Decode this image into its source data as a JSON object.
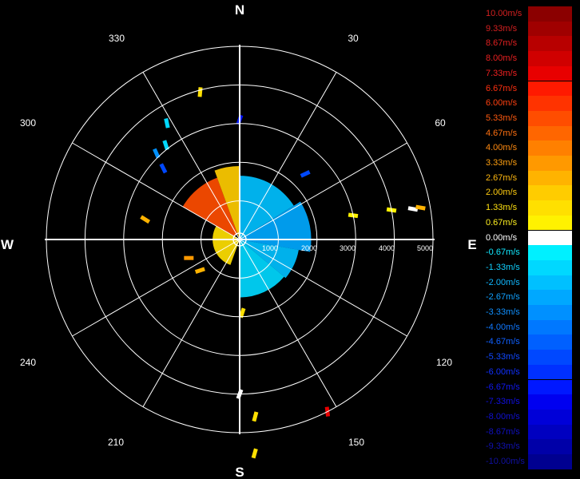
{
  "compass": {
    "north": "N",
    "south": "S",
    "east": "E",
    "west": "W",
    "bearings": [
      "30",
      "60",
      "120",
      "150",
      "210",
      "240",
      "300",
      "330"
    ]
  },
  "range_labels": [
    "1000",
    "2000",
    "3000",
    "4000",
    "5000"
  ],
  "colors": {
    "background": "#000000",
    "grid": "#ffffff"
  },
  "chart_data": {
    "type": "polar radial-velocity scan",
    "range_ticks": [
      1000,
      2000,
      3000,
      4000,
      5000
    ],
    "max_range": 5000,
    "bearing_ticks": [
      30,
      60,
      120,
      150,
      210,
      240,
      300,
      330
    ],
    "legend_placement": "right",
    "sectors": [
      {
        "az0": 0,
        "az1": 58,
        "r0": 0,
        "r1": 1650,
        "velocity": -2.0
      },
      {
        "az0": 58,
        "az1": 100,
        "r0": 0,
        "r1": 1850,
        "velocity": -2.67
      },
      {
        "az0": 100,
        "az1": 130,
        "r0": 0,
        "r1": 1550,
        "velocity": -2.0
      },
      {
        "az0": 130,
        "az1": 180,
        "r0": 0,
        "r1": 1500,
        "velocity": -1.33
      },
      {
        "az0": 300,
        "az1": 340,
        "r0": 150,
        "r1": 1700,
        "velocity": 5.33
      },
      {
        "az0": 340,
        "az1": 360,
        "r0": 0,
        "r1": 1900,
        "velocity": 2.0
      },
      {
        "az0": 200,
        "az1": 300,
        "r0": 0,
        "r1": 700,
        "velocity": 1.33
      }
    ],
    "returns": [
      {
        "az": 345,
        "range": 3950,
        "velocity": 1.33
      },
      {
        "az": 328,
        "range": 3550,
        "velocity": -1.33
      },
      {
        "az": 322,
        "range": 3100,
        "velocity": -1.33
      },
      {
        "az": 316,
        "range": 3100,
        "velocity": -3.33
      },
      {
        "az": 313,
        "range": 2700,
        "velocity": -5.33
      },
      {
        "az": 0,
        "range": 3100,
        "velocity": -6.67
      },
      {
        "az": 45,
        "range": 2400,
        "velocity": -5.33
      },
      {
        "az": 78,
        "range": 3000,
        "velocity": 0.67
      },
      {
        "az": 79,
        "range": 4000,
        "velocity": 0.67
      },
      {
        "az": 80,
        "range": 4550,
        "velocity": 0.0
      },
      {
        "az": 80,
        "range": 4750,
        "velocity": 2.67
      },
      {
        "az": 282,
        "range": 2500,
        "velocity": 2.67
      },
      {
        "az": 250,
        "range": 1400,
        "velocity": 3.33
      },
      {
        "az": 232,
        "range": 1300,
        "velocity": 2.67
      },
      {
        "az": 153,
        "range": 5000,
        "velocity": 7.33
      },
      {
        "az": 175,
        "range": 4600,
        "velocity": 1.33
      },
      {
        "az": 176,
        "range": 5550,
        "velocity": 1.33
      },
      {
        "az": 178,
        "range": 1900,
        "velocity": 1.33
      },
      {
        "az": 180,
        "range": 4000,
        "velocity": 0.0
      }
    ]
  },
  "legend": [
    {
      "label": "10.00m/s",
      "color": "#8b0000",
      "text": "#d42020"
    },
    {
      "label": "9.33m/s",
      "color": "#a00000",
      "text": "#d42020"
    },
    {
      "label": "8.67m/s",
      "color": "#b80000",
      "text": "#e02020"
    },
    {
      "label": "8.00m/s",
      "color": "#d00000",
      "text": "#e82020"
    },
    {
      "label": "7.33m/s",
      "color": "#e80000",
      "text": "#f02020"
    },
    {
      "label": "6.67m/s",
      "color": "#ff1a00",
      "text": "#ff3010"
    },
    {
      "label": "6.00m/s",
      "color": "#ff3300",
      "text": "#ff4010"
    },
    {
      "label": "5.33m/s",
      "color": "#ff4d00",
      "text": "#ff5a10"
    },
    {
      "label": "4.67m/s",
      "color": "#ff6600",
      "text": "#ff7010"
    },
    {
      "label": "4.00m/s",
      "color": "#ff8000",
      "text": "#ff8a10"
    },
    {
      "label": "3.33m/s",
      "color": "#ff9900",
      "text": "#ffa010"
    },
    {
      "label": "2.67m/s",
      "color": "#ffb300",
      "text": "#ffb810"
    },
    {
      "label": "2.00m/s",
      "color": "#ffcc00",
      "text": "#ffcc10"
    },
    {
      "label": "1.33m/s",
      "color": "#ffe000",
      "text": "#ffe010"
    },
    {
      "label": "0.67m/s",
      "color": "#fff200",
      "text": "#fff020"
    },
    {
      "label": "0.00m/s",
      "color": "#ffffff",
      "text": "#ffffff"
    },
    {
      "label": "-0.67m/s",
      "color": "#00f0ff",
      "text": "#10e8ff"
    },
    {
      "label": "-1.33m/s",
      "color": "#00d8ff",
      "text": "#10d0ff"
    },
    {
      "label": "-2.00m/s",
      "color": "#00c0ff",
      "text": "#10b8ff"
    },
    {
      "label": "-2.67m/s",
      "color": "#00a8ff",
      "text": "#10a0ff"
    },
    {
      "label": "-3.33m/s",
      "color": "#0090ff",
      "text": "#1090ff"
    },
    {
      "label": "-4.00m/s",
      "color": "#0078ff",
      "text": "#1078ff"
    },
    {
      "label": "-4.67m/s",
      "color": "#0060ff",
      "text": "#1060ff"
    },
    {
      "label": "-5.33m/s",
      "color": "#0048ff",
      "text": "#1048ff"
    },
    {
      "label": "-6.00m/s",
      "color": "#0030ff",
      "text": "#1030ff"
    },
    {
      "label": "-6.67m/s",
      "color": "#0018ff",
      "text": "#1018f0"
    },
    {
      "label": "-7.33m/s",
      "color": "#0000f0",
      "text": "#1010e0"
    },
    {
      "label": "-8.00m/s",
      "color": "#0000d8",
      "text": "#1010d0"
    },
    {
      "label": "-8.67m/s",
      "color": "#0000c0",
      "text": "#1010c0"
    },
    {
      "label": "-9.33m/s",
      "color": "#0000a8",
      "text": "#1010b0"
    },
    {
      "label": "-10.00m/s",
      "color": "#000090",
      "text": "#1010a0"
    }
  ]
}
